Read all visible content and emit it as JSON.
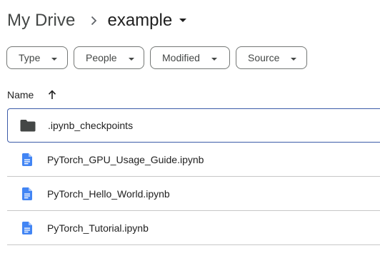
{
  "breadcrumb": {
    "root": "My Drive",
    "current": "example"
  },
  "filters": [
    {
      "label": "Type"
    },
    {
      "label": "People"
    },
    {
      "label": "Modified"
    },
    {
      "label": "Source"
    }
  ],
  "list_header": {
    "name_label": "Name",
    "sort": "ascending"
  },
  "files": [
    {
      "name": ".ipynb_checkpoints",
      "kind": "folder",
      "icon": "folder-icon",
      "selected": true
    },
    {
      "name": "PyTorch_GPU_Usage_Guide.ipynb",
      "kind": "document",
      "icon": "document-icon",
      "selected": false
    },
    {
      "name": "PyTorch_Hello_World.ipynb",
      "kind": "document",
      "icon": "document-icon",
      "selected": false
    },
    {
      "name": "PyTorch_Tutorial.ipynb",
      "kind": "document",
      "icon": "document-icon",
      "selected": false
    }
  ],
  "colors": {
    "folder": "#444746",
    "document": "#4285f4",
    "selection_border": "#3c5ba8",
    "divider": "#c7c7c7",
    "chip_border": "#747775"
  }
}
